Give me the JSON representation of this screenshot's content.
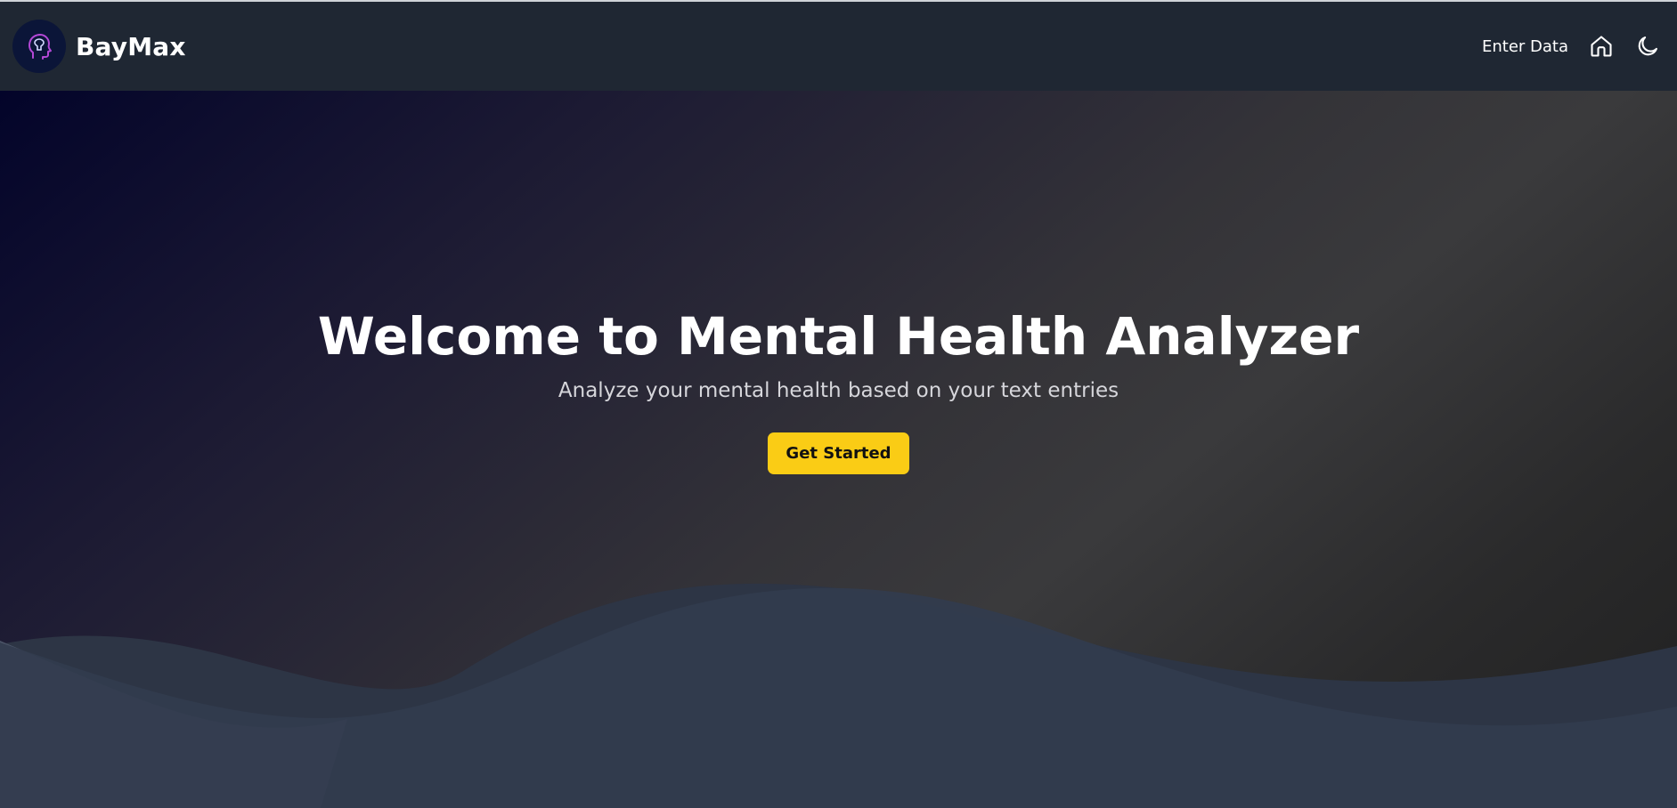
{
  "navbar": {
    "brand_name": "BayMax",
    "logo_icon": "brain-head-icon",
    "links": [
      {
        "label": "Enter Data"
      }
    ],
    "home_icon": "home-icon",
    "theme_icon": "moon-icon"
  },
  "hero": {
    "title": "Welcome to Mental Health Analyzer",
    "subtitle": "Analyze your mental health based on your text entries",
    "cta_label": "Get Started"
  },
  "colors": {
    "navbar_bg": "#1f2733",
    "cta_bg": "#facc15",
    "wave": "#2f3848",
    "logo_bg": "#0b1538",
    "logo_stroke": "#c04ad8"
  }
}
